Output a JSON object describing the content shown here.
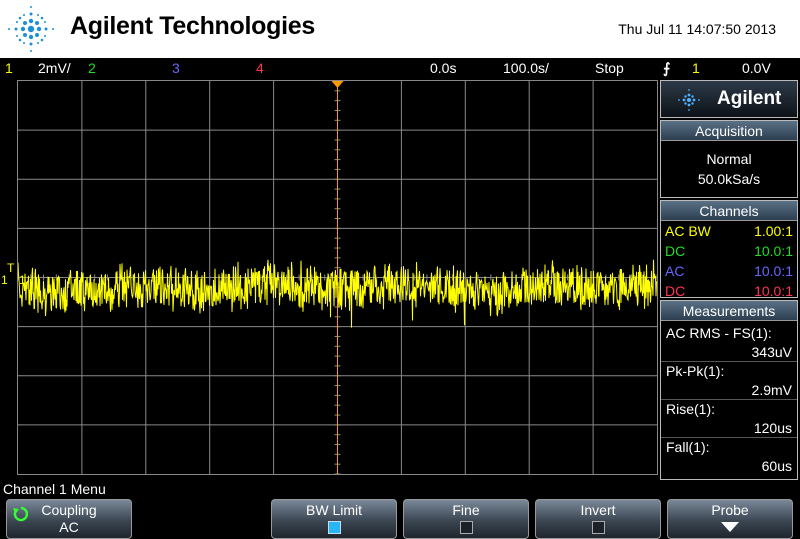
{
  "header": {
    "brand": "Agilent Technologies",
    "datetime": "Thu Jul 11 14:07:50 2013"
  },
  "status_bar": {
    "ch1_label": "1",
    "ch1_scale": "2mV/",
    "ch2_label": "2",
    "ch3_label": "3",
    "ch4_label": "4",
    "delay": "0.0s",
    "timebase": "100.0s/",
    "run_state": "Stop",
    "trigger_channel": "1",
    "trigger_level": "0.0V"
  },
  "colors": {
    "ch1": "#ffff00",
    "ch2": "#22dd22",
    "ch3": "#6666ff",
    "ch4": "#ff3355",
    "trigger_marker": "#ff9900",
    "grid": "#8a8a8a"
  },
  "markers": {
    "trigger_level_marker": "T",
    "ch1_ground_marker": "1"
  },
  "side_panel": {
    "brand": "Agilent",
    "acquisition": {
      "title": "Acquisition",
      "mode": "Normal",
      "sample_rate": "50.0kSa/s"
    },
    "channels": {
      "title": "Channels",
      "rows": [
        {
          "coupling": "AC BW",
          "probe": "1.00:1"
        },
        {
          "coupling": "DC",
          "probe": "10.0:1"
        },
        {
          "coupling": "AC",
          "probe": "10.0:1"
        },
        {
          "coupling": "DC",
          "probe": "10.0:1"
        }
      ]
    },
    "measurements": {
      "title": "Measurements",
      "items": [
        {
          "label": "AC RMS - FS(1):",
          "value": "343uV"
        },
        {
          "label": "Pk-Pk(1):",
          "value": "2.9mV"
        },
        {
          "label": "Rise(1):",
          "value": "120us"
        },
        {
          "label": "Fall(1):",
          "value": "60us"
        }
      ]
    }
  },
  "menu": {
    "title": "Channel 1 Menu",
    "softkeys": {
      "coupling": {
        "label": "Coupling",
        "value": "AC"
      },
      "bw_limit": {
        "label": "BW Limit",
        "checked": true
      },
      "fine": {
        "label": "Fine",
        "checked": false
      },
      "invert": {
        "label": "Invert",
        "checked": false
      },
      "probe": {
        "label": "Probe"
      }
    }
  },
  "waveform": {
    "channel": 1,
    "baseline_divisions": -0.2,
    "noise_amplitude_divisions": 0.5,
    "horizontal_divisions": 10,
    "vertical_divisions": 8
  }
}
